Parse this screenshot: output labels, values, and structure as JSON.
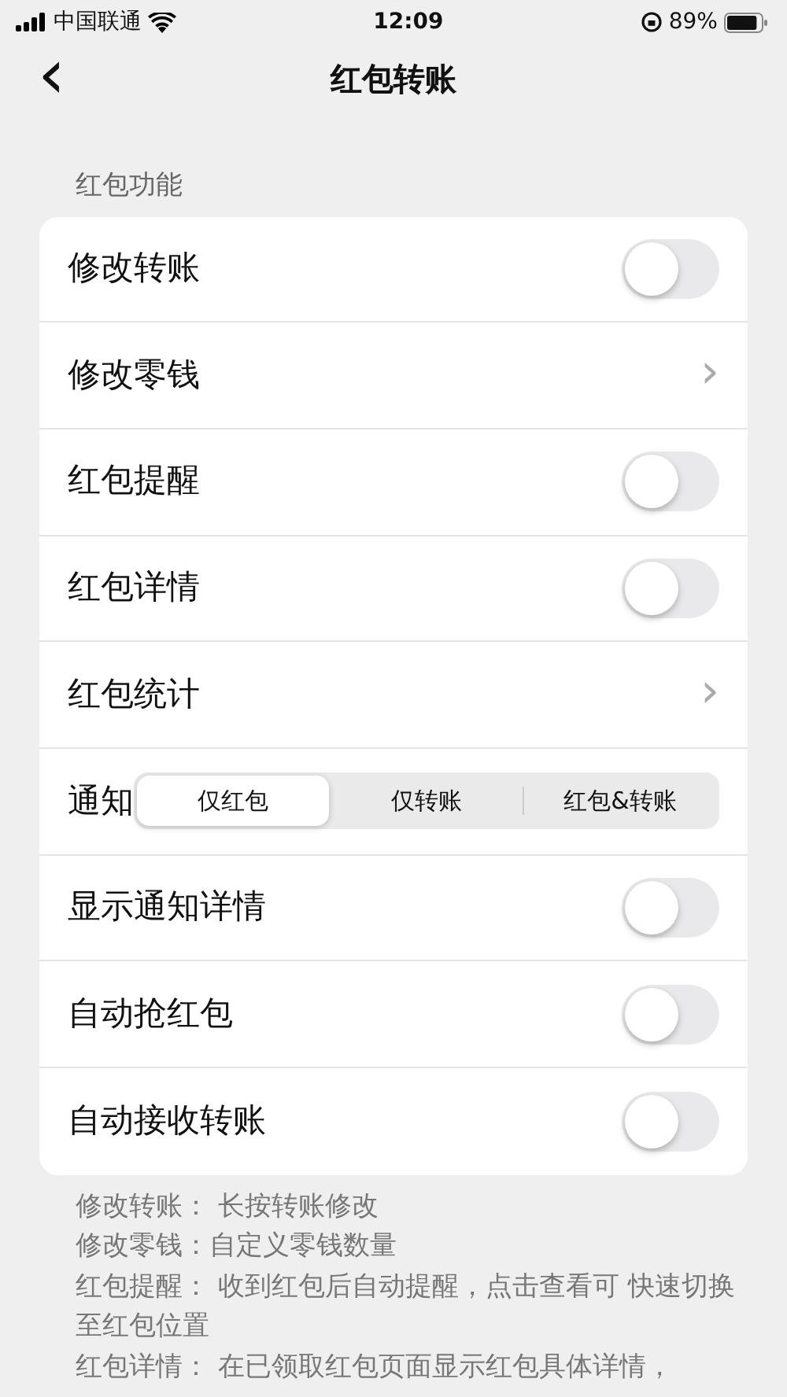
{
  "status_bar": {
    "carrier": "中国联通",
    "time": "12:09",
    "battery": "89%"
  },
  "nav": {
    "back": "‹",
    "title": "红包转账"
  },
  "section_label": "红包功能",
  "rows": [
    {
      "kind": "toggle",
      "label": "修改转账",
      "on": false
    },
    {
      "kind": "link",
      "label": "修改零钱",
      "chevron": "›"
    },
    {
      "kind": "toggle",
      "label": "红包提醒",
      "on": false
    },
    {
      "kind": "toggle",
      "label": "红包详情",
      "on": false
    },
    {
      "kind": "link",
      "label": "红包统计",
      "chevron": "›"
    },
    {
      "kind": "segment",
      "label": "通知",
      "options": [
        {
          "label": "仅红包",
          "selected": true
        },
        {
          "label": "仅转账",
          "selected": false
        },
        {
          "label": "红包&转账",
          "selected": false
        }
      ]
    },
    {
      "kind": "toggle",
      "label": "显示通知详情",
      "on": false
    },
    {
      "kind": "toggle",
      "label": "自动抢红包",
      "on": false
    },
    {
      "kind": "toggle",
      "label": "自动接收转账",
      "on": false
    }
  ],
  "notes": [
    "修改转账： 长按转账修改",
    "修改零钱：自定义零钱数量",
    "红包提醒： 收到红包后自动提醒，点击查看可 快速切换至红包位置",
    "红包详情： 在已领取红包页面显示红包具体详情，"
  ]
}
